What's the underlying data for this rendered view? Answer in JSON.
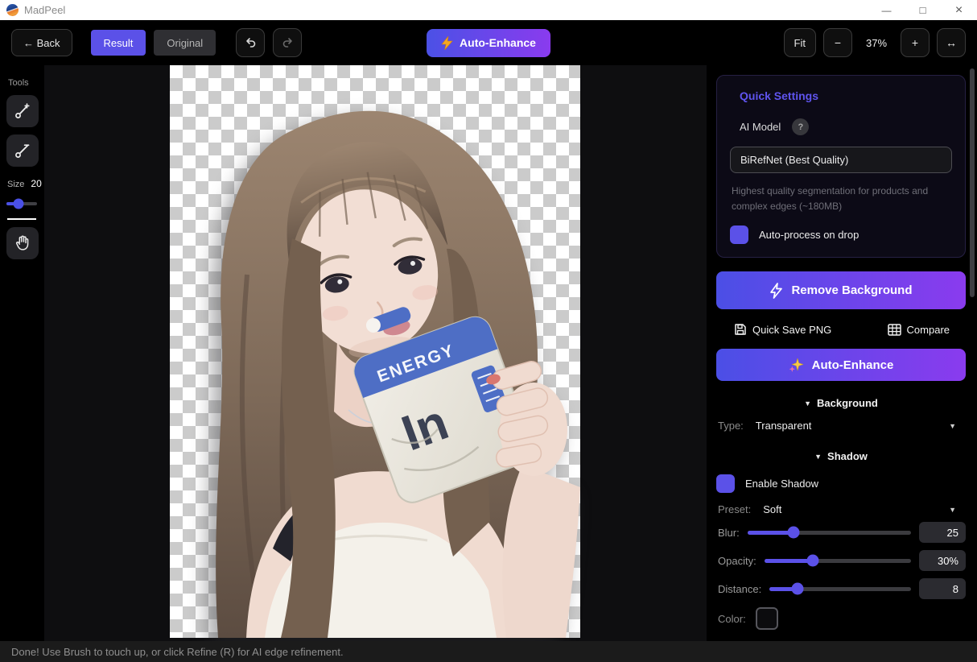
{
  "window": {
    "title": "MadPeel",
    "controls": {
      "minimize": "—",
      "maximize": "□",
      "close": "×"
    }
  },
  "toolbar": {
    "back_label": "← Back",
    "tabs": [
      {
        "label": "Result",
        "active": true
      },
      {
        "label": "Original",
        "active": false
      }
    ],
    "auto_enhance_label": "Auto-Enhance",
    "fit_label": "Fit",
    "zoom_out_label": "−",
    "zoom_level": "37%",
    "zoom_in_label": "+",
    "fit_width_icon": "↔"
  },
  "tools_panel": {
    "title": "Tools",
    "size_label": "Size",
    "size_value": "20",
    "size_percent": 40
  },
  "quick_settings": {
    "title": "Quick Settings",
    "ai_model_label": "AI Model",
    "help_badge": "?",
    "model_value": "BiRefNet (Best Quality)",
    "model_description": "Highest quality segmentation for products and complex edges (~180MB)",
    "auto_process_label": "Auto-process on drop"
  },
  "actions": {
    "remove_background_label": "Remove Background",
    "quick_save_label": "Quick Save PNG",
    "compare_label": "Compare",
    "auto_enhance_label": "Auto-Enhance"
  },
  "background_section": {
    "collapse_icon": "▼",
    "title": "Background",
    "type_label": "Type:",
    "type_value": "Transparent",
    "caret_icon": "▼"
  },
  "shadow_section": {
    "collapse_icon": "▼",
    "title": "Shadow",
    "enable_label": "Enable Shadow",
    "preset_label": "Preset:",
    "preset_value": "Soft",
    "caret_icon": "▼",
    "sliders": [
      {
        "label": "Blur:",
        "value": "25",
        "percent": 28
      },
      {
        "label": "Opacity:",
        "value": "30%",
        "percent": 33
      },
      {
        "label": "Distance:",
        "value": "8",
        "percent": 20
      }
    ],
    "color_label": "Color:"
  },
  "status_bar": {
    "message": "Done! Use Brush to touch up, or click Refine (R) for AI edge refinement."
  },
  "colors": {
    "accent": "#5b51e8",
    "gradient_start": "#4b4fe6",
    "gradient_end": "#8a3bee",
    "canvas_bg": "#0e0e10",
    "panel_card_bg": "#0c0a16"
  }
}
